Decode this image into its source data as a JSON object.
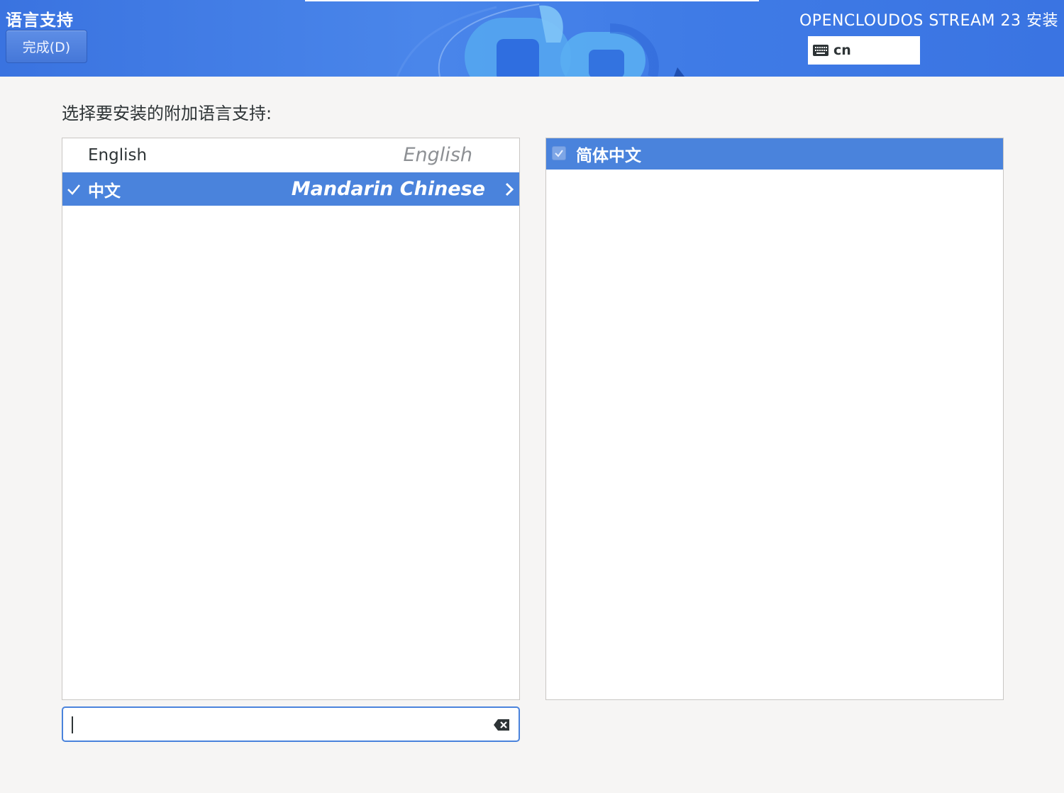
{
  "header": {
    "spoke_title": "语言支持",
    "done_label": "完成(D)",
    "product_title": "OPENCLOUDOS STREAM 23 安装",
    "keyboard_layout": "cn",
    "keyboard_icon": "keyboard-icon"
  },
  "main": {
    "prompt": "选择要安装的附加语言支持:",
    "languages": [
      {
        "native": "English",
        "english": "English",
        "checked": false,
        "selected": false
      },
      {
        "native": "中文",
        "english": "Mandarin Chinese",
        "checked": true,
        "selected": true
      }
    ],
    "locales": [
      {
        "label": "简体中文",
        "checked": true,
        "selected": true
      }
    ],
    "search": {
      "value": "",
      "placeholder": ""
    }
  },
  "colors": {
    "accent": "#4a83dc",
    "header": "#3f7be6",
    "background": "#f6f5f4"
  }
}
